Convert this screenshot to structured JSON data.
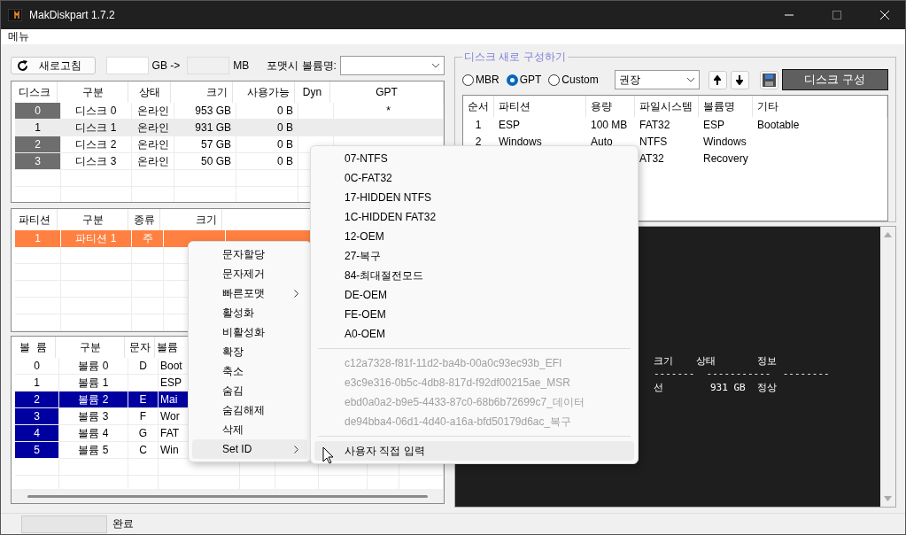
{
  "window": {
    "title": "MakDiskpart 1.7.2"
  },
  "menu_bar": [
    "메뉴"
  ],
  "toolbar": {
    "refresh": "새로고침",
    "gb_unit": "GB ->",
    "mb_unit": "MB",
    "volume_label": "포맷시 볼륨명:"
  },
  "disks": {
    "columns": [
      "디스크",
      "구분",
      "상태",
      "크기",
      "사용가능",
      "Dyn",
      "GPT"
    ],
    "rows": [
      {
        "index": "0",
        "name": "디스크 0",
        "status": "온라인",
        "size": "953 GB",
        "free": "0 B",
        "gpt": "*",
        "selected": false
      },
      {
        "index": "1",
        "name": "디스크 1",
        "status": "온라인",
        "size": "931 GB",
        "free": "0 B",
        "selected": true
      },
      {
        "index": "2",
        "name": "디스크 2",
        "status": "온라인",
        "size": "57 GB",
        "free": "0 B",
        "selected": false
      },
      {
        "index": "3",
        "name": "디스크 3",
        "status": "온라인",
        "size": "50 GB",
        "free": "0 B",
        "selected": false
      }
    ]
  },
  "partitions": {
    "columns": [
      "파티션",
      "구분",
      "종류",
      "크기"
    ],
    "rows": [
      {
        "index": "1",
        "name": "파티션 1",
        "type": "주",
        "selected": true
      }
    ]
  },
  "volumes": {
    "columns": [
      "볼  륨",
      "구분",
      "문자",
      "볼륨"
    ],
    "rows": [
      {
        "index": "0",
        "name": "볼륨 0",
        "letter": "D",
        "label": "Boot",
        "marked": false,
        "selected": false
      },
      {
        "index": "1",
        "name": "볼륨 1",
        "label": "ESP",
        "marked": false,
        "selected": false
      },
      {
        "index": "2",
        "name": "볼륨 2",
        "letter": "E",
        "label": "Mai",
        "marked": true,
        "selected": true
      },
      {
        "index": "3",
        "name": "볼륨 3",
        "letter": "F",
        "label": "Wor",
        "marked": true,
        "selected": false
      },
      {
        "index": "4",
        "name": "볼륨 4",
        "letter": "G",
        "label": "FAT",
        "marked": true,
        "selected": false
      },
      {
        "index": "5",
        "name": "볼륨 5",
        "letter": "C",
        "label": "Win",
        "marked": true,
        "selected": false
      }
    ]
  },
  "new_layout": {
    "title": "디스크 새로 구성하기",
    "schemes": [
      {
        "label": "MBR",
        "selected": false
      },
      {
        "label": "GPT",
        "selected": true
      },
      {
        "label": "Custom",
        "selected": false
      }
    ],
    "preset": "권장",
    "apply": "디스크 구성",
    "columns": [
      "순서",
      "파티션",
      "용량",
      "파일시스템",
      "볼륨명",
      "기타"
    ],
    "rows": [
      {
        "order": "1",
        "partition": "ESP",
        "size": "100 MB",
        "filesystem": "FAT32",
        "label": "ESP",
        "other": "Bootable"
      },
      {
        "order": "2",
        "partition": "Windows",
        "size": "Auto",
        "filesystem": "NTFS",
        "label": "Windows"
      },
      {
        "filesystem": "AT32",
        "label": "Recovery"
      }
    ]
  },
  "console": {
    "lines": [
      "크기    상태       정보",
      "-------  -----------  --------",
      "선        931 GB  정상"
    ]
  },
  "context_menu": {
    "items": [
      {
        "label": "문자할당",
        "submenu": false,
        "selected": false
      },
      {
        "label": "문자제거",
        "submenu": false,
        "selected": false
      },
      {
        "label": "빠른포맷",
        "submenu": true,
        "selected": false
      },
      {
        "label": "활성화",
        "submenu": false,
        "selected": false
      },
      {
        "label": "비활성화",
        "submenu": false,
        "selected": false
      },
      {
        "label": "확장",
        "submenu": false,
        "selected": false
      },
      {
        "label": "축소",
        "submenu": false,
        "selected": false
      },
      {
        "label": "숨김",
        "submenu": false,
        "selected": false
      },
      {
        "label": "숨김해제",
        "submenu": false,
        "selected": false
      },
      {
        "label": "삭제",
        "submenu": false,
        "selected": false
      },
      {
        "label": "Set ID",
        "submenu": true,
        "selected": true
      }
    ]
  },
  "submenu": {
    "groups": [
      [
        {
          "label": "07-NTFS",
          "disabled": false,
          "selected": false
        },
        {
          "label": "0C-FAT32",
          "disabled": false,
          "selected": false
        },
        {
          "label": "17-HIDDEN NTFS",
          "disabled": false,
          "selected": false
        },
        {
          "label": "1C-HIDDEN FAT32",
          "disabled": false,
          "selected": false
        },
        {
          "label": "12-OEM",
          "disabled": false,
          "selected": false
        },
        {
          "label": "27-복구",
          "disabled": false,
          "selected": false
        },
        {
          "label": "84-최대절전모드",
          "disabled": false,
          "selected": false
        },
        {
          "label": "DE-OEM",
          "disabled": false,
          "selected": false
        },
        {
          "label": "FE-OEM",
          "disabled": false,
          "selected": false
        },
        {
          "label": "A0-OEM",
          "disabled": false,
          "selected": false
        }
      ],
      [
        {
          "label": "c12a7328-f81f-11d2-ba4b-00a0c93ec93b_EFI",
          "disabled": true,
          "selected": false
        },
        {
          "label": "e3c9e316-0b5c-4db8-817d-f92df00215ae_MSR",
          "disabled": true,
          "selected": false
        },
        {
          "label": "ebd0a0a2-b9e5-4433-87c0-68b6b72699c7_데이터",
          "disabled": true,
          "selected": false
        },
        {
          "label": "de94bba4-06d1-4d40-a16a-bfd50179d6ac_복구",
          "disabled": true,
          "selected": false
        }
      ],
      [
        {
          "label": "사용자 직접 입력",
          "disabled": false,
          "selected": true
        }
      ]
    ]
  },
  "status_bar": {
    "text": "완료"
  }
}
